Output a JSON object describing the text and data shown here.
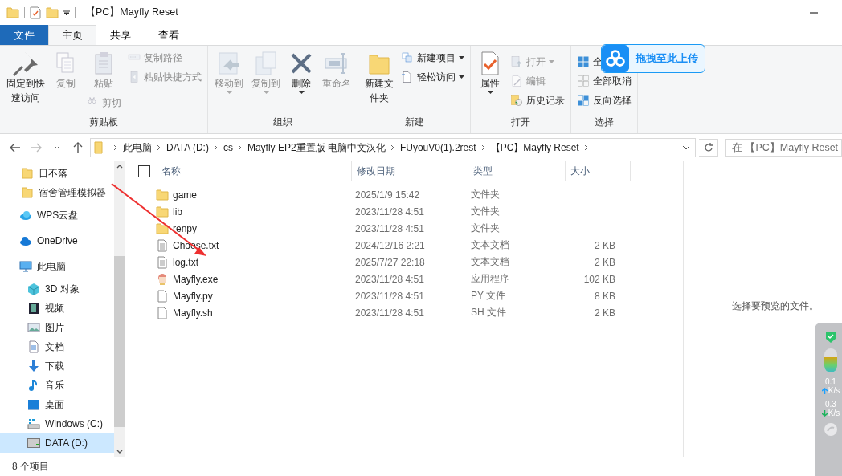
{
  "window": {
    "title": "【PC】Mayfly Reset"
  },
  "ribbon_tabs": [
    {
      "label": "文件",
      "kind": "file",
      "selected": false
    },
    {
      "label": "主页",
      "kind": "tab",
      "selected": true
    },
    {
      "label": "共享",
      "kind": "tab",
      "selected": false
    },
    {
      "label": "查看",
      "kind": "tab",
      "selected": false
    }
  ],
  "ribbon": {
    "groups": [
      {
        "label": "剪贴板",
        "columns": [
          [
            {
              "kind": "large",
              "label": "固定到快速访问",
              "disabled": false,
              "dropdown": false
            }
          ],
          [
            {
              "kind": "large",
              "label": "复制",
              "disabled": true,
              "dropdown": false
            }
          ],
          [
            {
              "kind": "large",
              "label": "粘贴",
              "disabled": true,
              "dropdown": false
            },
            {
              "kind": "small",
              "label": "剪切",
              "disabled": true,
              "dropdown": false
            }
          ],
          [
            {
              "kind": "small",
              "label": "复制路径",
              "disabled": true,
              "dropdown": false
            },
            {
              "kind": "small",
              "label": "粘贴快捷方式",
              "disabled": true,
              "dropdown": false
            }
          ]
        ]
      },
      {
        "label": "组织",
        "columns": [
          [
            {
              "kind": "large",
              "label": "移动到",
              "disabled": true,
              "dropdown": true
            }
          ],
          [
            {
              "kind": "large",
              "label": "复制到",
              "disabled": true,
              "dropdown": true
            }
          ],
          [
            {
              "kind": "large",
              "label": "删除",
              "disabled": false,
              "dropdown": true
            }
          ],
          [
            {
              "kind": "large",
              "label": "重命名",
              "disabled": true,
              "dropdown": false
            }
          ]
        ]
      },
      {
        "label": "新建",
        "columns": [
          [
            {
              "kind": "large",
              "label": "新建文件夹",
              "disabled": false,
              "dropdown": false
            }
          ],
          [
            {
              "kind": "small",
              "label": "新建项目",
              "disabled": false,
              "dropdown": true
            },
            {
              "kind": "small",
              "label": "轻松访问",
              "disabled": false,
              "dropdown": true
            }
          ]
        ]
      },
      {
        "label": "打开",
        "columns": [
          [
            {
              "kind": "large",
              "label": "属性",
              "disabled": false,
              "dropdown": true
            }
          ],
          [
            {
              "kind": "small",
              "label": "打开",
              "disabled": true,
              "dropdown": true
            },
            {
              "kind": "small",
              "label": "编辑",
              "disabled": true,
              "dropdown": false
            },
            {
              "kind": "small",
              "label": "历史记录",
              "disabled": false,
              "dropdown": false
            }
          ]
        ]
      },
      {
        "label": "选择",
        "columns": [
          [
            {
              "kind": "small",
              "label": "全",
              "disabled": false,
              "dropdown": false
            },
            {
              "kind": "small",
              "label": "全部取消",
              "disabled": false,
              "dropdown": false
            },
            {
              "kind": "small",
              "label": "反向选择",
              "disabled": false,
              "dropdown": false
            }
          ]
        ]
      }
    ]
  },
  "upload_badge": {
    "label": "拖拽至此上传"
  },
  "address_bar": {
    "path": [
      "此电脑",
      "DATA (D:)",
      "cs",
      "Mayfly EP2重置版 电脑中文汉化",
      "FUyouV0(1).2rest",
      "【PC】Mayfly Reset"
    ]
  },
  "search": {
    "placeholder": "在 【PC】Mayfly Reset"
  },
  "navigation": {
    "pinned": [
      {
        "label": "日不落",
        "kind": "folder",
        "selected": false
      },
      {
        "label": "宿舍管理模拟器",
        "kind": "folder",
        "selected": false
      }
    ],
    "items": [
      {
        "label": "WPS云盘",
        "kind": "wps",
        "selected": false
      },
      {
        "label": "OneDrive",
        "kind": "onedrive",
        "selected": false
      },
      {
        "label": "此电脑",
        "kind": "computer",
        "selected": false,
        "children": [
          {
            "label": "3D 对象",
            "kind": "cube",
            "selected": false
          },
          {
            "label": "视频",
            "kind": "video",
            "selected": false
          },
          {
            "label": "图片",
            "kind": "picture",
            "selected": false
          },
          {
            "label": "文档",
            "kind": "document",
            "selected": false
          },
          {
            "label": "下载",
            "kind": "download",
            "selected": false
          },
          {
            "label": "音乐",
            "kind": "music",
            "selected": false
          },
          {
            "label": "桌面",
            "kind": "desktop",
            "selected": false
          },
          {
            "label": "Windows (C:)",
            "kind": "system-drive",
            "selected": false
          },
          {
            "label": "DATA (D:)",
            "kind": "drive",
            "selected": true
          }
        ]
      }
    ]
  },
  "file_list": {
    "select_all": {
      "checked": false
    },
    "columns": [
      "名称",
      "修改日期",
      "类型",
      "大小"
    ],
    "rows": [
      {
        "name": "game",
        "modified": "2025/1/9 15:42",
        "type": "文件夹",
        "size": "",
        "kind": "folder"
      },
      {
        "name": "lib",
        "modified": "2023/11/28 4:51",
        "type": "文件夹",
        "size": "",
        "kind": "folder"
      },
      {
        "name": "renpy",
        "modified": "2023/11/28 4:51",
        "type": "文件夹",
        "size": "",
        "kind": "folder"
      },
      {
        "name": "Choose.txt",
        "modified": "2024/12/16 2:21",
        "type": "文本文档",
        "size": "2 KB",
        "kind": "text"
      },
      {
        "name": "log.txt",
        "modified": "2025/7/27 22:18",
        "type": "文本文档",
        "size": "2 KB",
        "kind": "text"
      },
      {
        "name": "Mayfly.exe",
        "modified": "2023/11/28 4:51",
        "type": "应用程序",
        "size": "102 KB",
        "kind": "app"
      },
      {
        "name": "Mayfly.py",
        "modified": "2023/11/28 4:51",
        "type": "PY 文件",
        "size": "8 KB",
        "kind": "file"
      },
      {
        "name": "Mayfly.sh",
        "modified": "2023/11/28 4:51",
        "type": "SH 文件",
        "size": "2 KB",
        "kind": "file"
      }
    ]
  },
  "preview_pane": {
    "message": "选择要预览的文件。"
  },
  "status_bar": {
    "item_count": "8 个项目"
  },
  "monitor_widget": {
    "level": 0.62,
    "upload": {
      "value": "0.1",
      "unit": "K/s"
    },
    "download": {
      "value": "0.3",
      "unit": "K/s"
    }
  }
}
